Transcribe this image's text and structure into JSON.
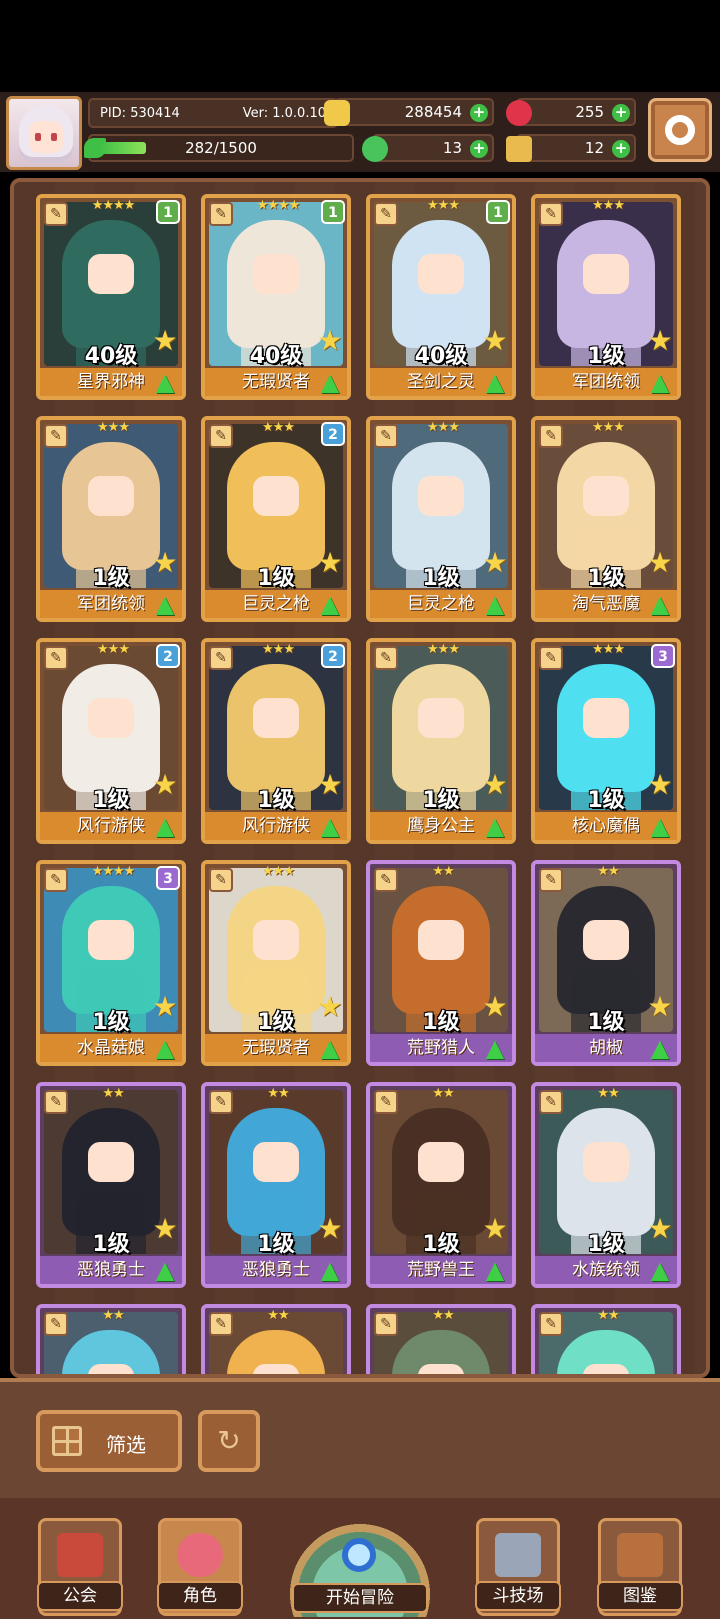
{
  "header": {
    "pid": "PID: 530414",
    "version": "Ver: 1.0.0.10",
    "exp": "282/1500",
    "exp_fraction": 0.188,
    "gold": "288454",
    "gems": "255",
    "clover": "13",
    "key": "12"
  },
  "roster": [
    {
      "level": "40级",
      "name": "星界邪神",
      "stars": "★★★★",
      "rank": "1",
      "frame": "gold",
      "hair": "#2f6b5f",
      "bg": "#2a3f3a",
      "rank_color": "#5fae4b"
    },
    {
      "level": "40级",
      "name": "无瑕贤者",
      "stars": "★★★★",
      "rank": "1",
      "frame": "gold",
      "hair": "#efe6da",
      "bg": "#6ab5c6",
      "rank_color": "#5fae4b"
    },
    {
      "level": "40级",
      "name": "圣剑之灵",
      "stars": "★★★",
      "rank": "1",
      "frame": "gold",
      "hair": "#cfe3f3",
      "bg": "#6c5a41",
      "rank_color": "#5fae4b"
    },
    {
      "level": "1级",
      "name": "军团统领",
      "stars": "★★★",
      "rank": "",
      "frame": "gold",
      "hair": "#c7b6e2",
      "bg": "#3a2f4a",
      "rank_color": ""
    },
    {
      "level": "1级",
      "name": "军团统领",
      "stars": "★★★",
      "rank": "",
      "frame": "gold",
      "hair": "#e8c594",
      "bg": "#3f5a74",
      "rank_color": ""
    },
    {
      "level": "1级",
      "name": "巨灵之枪",
      "stars": "★★★",
      "rank": "2",
      "frame": "gold",
      "hair": "#f0bf5a",
      "bg": "#3d3328",
      "rank_color": "#4aa0d8"
    },
    {
      "level": "1级",
      "name": "巨灵之枪",
      "stars": "★★★",
      "rank": "",
      "frame": "gold",
      "hair": "#d4e4ee",
      "bg": "#4f6a7a",
      "rank_color": ""
    },
    {
      "level": "1级",
      "name": "淘气恶魔",
      "stars": "★★★",
      "rank": "",
      "frame": "gold",
      "hair": "#f3d7a4",
      "bg": "#6a4c3b",
      "rank_color": ""
    },
    {
      "level": "1级",
      "name": "风行游侠",
      "stars": "★★★",
      "rank": "2",
      "frame": "gold",
      "hair": "#f2ece6",
      "bg": "#6a4a32",
      "rank_color": "#4aa0d8"
    },
    {
      "level": "1级",
      "name": "风行游侠",
      "stars": "★★★",
      "rank": "2",
      "frame": "gold",
      "hair": "#ebc36a",
      "bg": "#2d3340",
      "rank_color": "#4aa0d8"
    },
    {
      "level": "1级",
      "name": "鹰身公主",
      "stars": "★★★",
      "rank": "",
      "frame": "gold",
      "hair": "#efd8a0",
      "bg": "#4b5c58",
      "rank_color": ""
    },
    {
      "level": "1级",
      "name": "核心魔偶",
      "stars": "★★★",
      "rank": "3",
      "frame": "gold",
      "hair": "#4ee0f0",
      "bg": "#28394a",
      "rank_color": "#9a6ad1"
    },
    {
      "level": "1级",
      "name": "水晶菇娘",
      "stars": "★★★★",
      "rank": "3",
      "frame": "gold",
      "hair": "#3fc9b7",
      "bg": "#3e8bb5",
      "rank_color": "#9a6ad1"
    },
    {
      "level": "1级",
      "name": "无瑕贤者",
      "stars": "★★★",
      "rank": "",
      "frame": "gold",
      "hair": "#f4d585",
      "bg": "#ddd6cb",
      "rank_color": ""
    },
    {
      "level": "1级",
      "name": "荒野猎人",
      "stars": "★★",
      "rank": "",
      "frame": "purple",
      "hair": "#c46d2c",
      "bg": "#6a5242",
      "rank_color": ""
    },
    {
      "level": "1级",
      "name": "胡椒",
      "stars": "★★",
      "rank": "",
      "frame": "purple",
      "hair": "#2a2a30",
      "bg": "#7c6a56",
      "rank_color": ""
    },
    {
      "level": "1级",
      "name": "恶狼勇士",
      "stars": "★★",
      "rank": "",
      "frame": "purple",
      "hair": "#23242e",
      "bg": "#4c3a33",
      "rank_color": ""
    },
    {
      "level": "1级",
      "name": "恶狼勇士",
      "stars": "★★",
      "rank": "",
      "frame": "purple",
      "hair": "#42a7d6",
      "bg": "#5a3a2b",
      "rank_color": ""
    },
    {
      "level": "1级",
      "name": "荒野兽王",
      "stars": "★★",
      "rank": "",
      "frame": "purple",
      "hair": "#4a2f24",
      "bg": "#6a4a34",
      "rank_color": ""
    },
    {
      "level": "1级",
      "name": "水族统领",
      "stars": "★★",
      "rank": "",
      "frame": "purple",
      "hair": "#dce3ea",
      "bg": "#3c5a58",
      "rank_color": ""
    },
    {
      "level": "",
      "name": "",
      "stars": "★★",
      "rank": "",
      "frame": "purple",
      "hair": "#5fc6de",
      "bg": "#4b5f6e",
      "rank_color": ""
    },
    {
      "level": "",
      "name": "",
      "stars": "★★",
      "rank": "",
      "frame": "purple",
      "hair": "#f0b24e",
      "bg": "#6a4a34",
      "rank_color": ""
    },
    {
      "level": "",
      "name": "",
      "stars": "★★",
      "rank": "",
      "frame": "purple",
      "hair": "#6f8a6a",
      "bg": "#5a4d3c",
      "rank_color": ""
    },
    {
      "level": "",
      "name": "",
      "stars": "★★",
      "rank": "",
      "frame": "purple",
      "hair": "#6fe0c6",
      "bg": "#4b6b6a",
      "rank_color": ""
    }
  ],
  "bottom": {
    "filter_label": "筛选"
  },
  "nav": {
    "guild": "公会",
    "character": "角色",
    "adventure": "开始冒险",
    "arena": "斗技场",
    "codex": "图鉴"
  }
}
